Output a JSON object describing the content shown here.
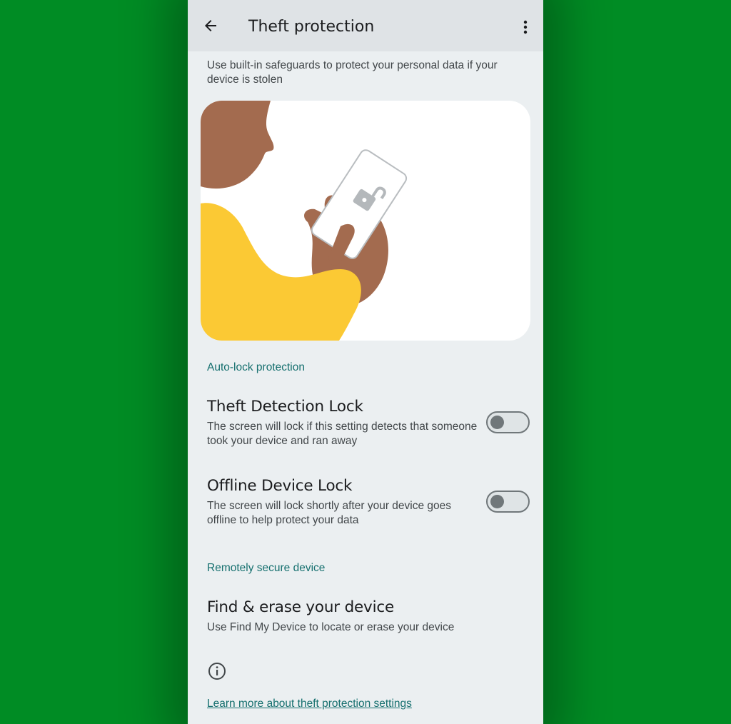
{
  "appbar": {
    "title": "Theft protection",
    "back_icon": "arrow-back-icon",
    "more_icon": "more-vert-icon"
  },
  "intro": "Use built-in safeguards to protect your personal data if your device is stolen",
  "illustration": {
    "name": "person-unlocking-phone-illustration",
    "colors": {
      "skin": "#a36b4f",
      "shirt": "#fbc934",
      "phone": "#ffffff",
      "lock": "#b4b8bb"
    }
  },
  "sections": [
    {
      "header": "Auto-lock protection",
      "items": [
        {
          "title": "Theft Detection Lock",
          "subtitle": "The screen will lock if this setting detects that someone took your device and ran away",
          "toggle": false
        },
        {
          "title": "Offline Device Lock",
          "subtitle": "The screen will lock shortly after your device goes offline to help protect your data",
          "toggle": false
        }
      ]
    },
    {
      "header": "Remotely secure device",
      "items": [
        {
          "title": "Find & erase your device",
          "subtitle": "Use Find My Device to locate or erase your device"
        }
      ]
    }
  ],
  "footer": {
    "info_icon": "info-icon",
    "link": "Learn more about theft protection settings"
  },
  "colors": {
    "background": "#008c24",
    "surface": "#ebeff1",
    "appbar": "#dfe3e6",
    "accent": "#16706f"
  }
}
